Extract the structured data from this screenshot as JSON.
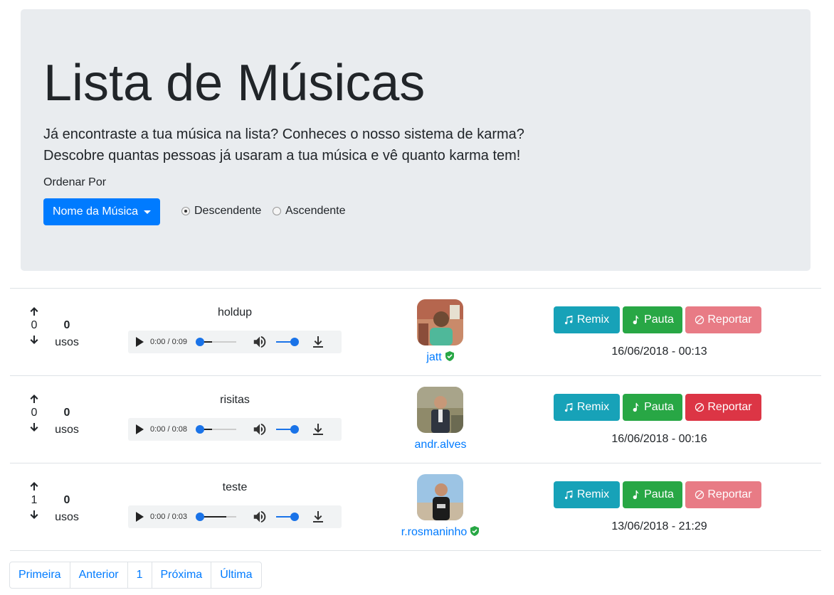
{
  "header": {
    "title": "Lista de Músicas",
    "lead_line1": "Já encontraste a tua música na lista? Conheces o nosso sistema de karma?",
    "lead_line2": "Descobre quantas pessoas já usaram a tua música e vê quanto karma tem!",
    "order_label": "Ordenar Por",
    "order_dropdown_value": "Nome da Música",
    "radio_desc": "Descendente",
    "radio_asc": "Ascendente",
    "selected_order": "Descendente"
  },
  "tracks": [
    {
      "votes": "0",
      "uses": "0",
      "uses_label": "usos",
      "title": "holdup",
      "time": "0:00 / 0:09",
      "author": "jatt",
      "author_verified": true,
      "remix_label": "Remix",
      "pauta_label": "Pauta",
      "report_label": "Reportar",
      "report_enabled": false,
      "date": "16/06/2018 - 00:13"
    },
    {
      "votes": "0",
      "uses": "0",
      "uses_label": "usos",
      "title": "risitas",
      "time": "0:00 / 0:08",
      "author": "andr.alves",
      "author_verified": false,
      "remix_label": "Remix",
      "pauta_label": "Pauta",
      "report_label": "Reportar",
      "report_enabled": true,
      "date": "16/06/2018 - 00:16"
    },
    {
      "votes": "1",
      "uses": "0",
      "uses_label": "usos",
      "title": "teste",
      "time": "0:00 / 0:03",
      "author": "r.rosmaninho",
      "author_verified": true,
      "remix_label": "Remix",
      "pauta_label": "Pauta",
      "report_label": "Reportar",
      "report_enabled": false,
      "date": "13/06/2018 - 21:29"
    }
  ],
  "pagination": {
    "first": "Primeira",
    "prev": "Anterior",
    "current": "1",
    "next": "Próxima",
    "last": "Última"
  },
  "colors": {
    "primary": "#007bff",
    "remix": "#17a2b8",
    "pauta": "#28a745",
    "report": "#dc3545",
    "verified": "#28a745",
    "jumbotron_bg": "#e9ecef"
  },
  "icons": {
    "upvote": "arrow-up-icon",
    "downvote": "arrow-down-icon",
    "play": "play-icon",
    "volume": "volume-icon",
    "download": "download-icon",
    "remix": "music-notes-icon",
    "pauta": "music-note-icon",
    "report": "ban-icon",
    "verified": "verified-shield-icon"
  }
}
